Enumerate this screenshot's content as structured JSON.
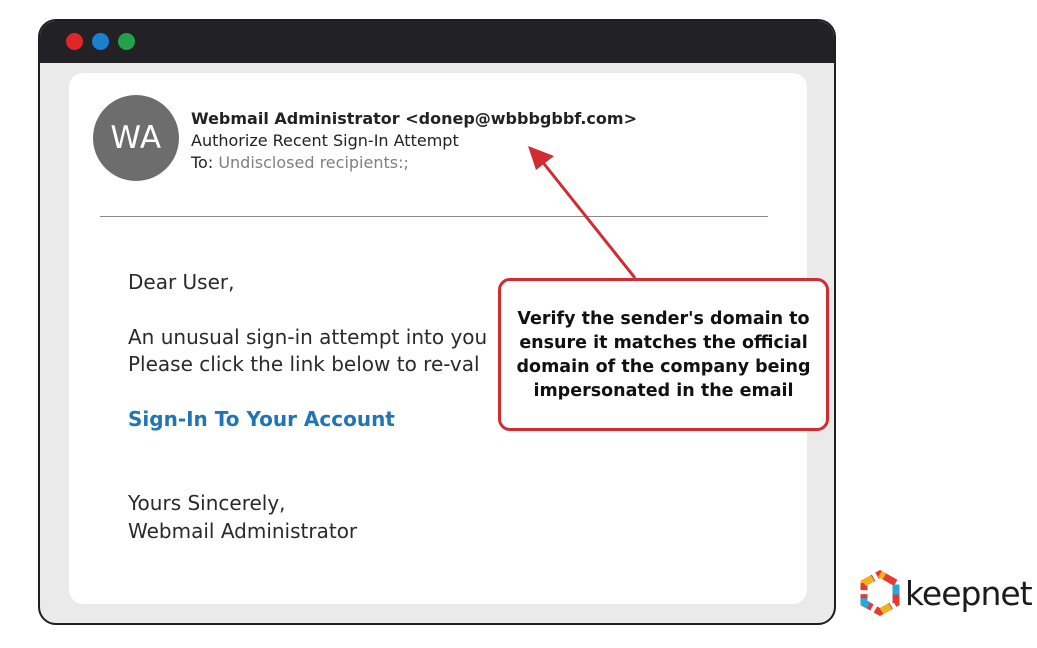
{
  "window": {
    "buttons": [
      "close",
      "minimize",
      "maximize"
    ],
    "colors": {
      "close": "#e0262b",
      "minimize": "#1b7fd0",
      "maximize": "#21a24a"
    }
  },
  "email": {
    "avatar_initials": "WA",
    "sender": "Webmail Administrator <donep@wbbbgbbf.com>",
    "subject": "Authorize Recent Sign-In Attempt",
    "to_label": "To:",
    "recipients": "Undisclosed recipients:;",
    "greeting": "Dear User,",
    "line1": "An unusual sign-in attempt into you",
    "line2": "Please click the link below  to  re-val",
    "link_text": "Sign-In To Your Account",
    "closing": "Yours Sincerely,",
    "signature": "Webmail Administrator"
  },
  "callout": {
    "text": "Verify the sender's domain to ensure it matches the official domain of the company being impersonated in the email",
    "color": "#d22b31"
  },
  "logo": {
    "text": "keepnet",
    "icon": "keepnet-logo-icon"
  }
}
